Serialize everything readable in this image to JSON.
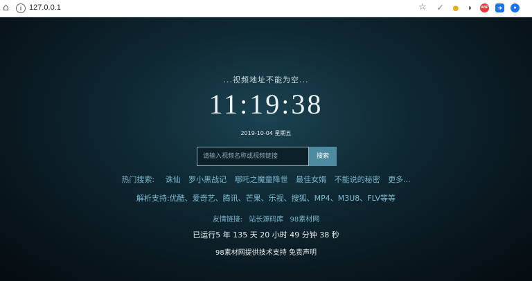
{
  "browser": {
    "url": "127.0.0.1",
    "info_icon": "i",
    "home_icon": "⌂",
    "star_icon": "☆",
    "extensions": [
      {
        "name": "check-icon",
        "glyph": "✓",
        "color": "#9aa0a6"
      },
      {
        "name": "smiley-extension-icon",
        "glyph": "☻",
        "color": "#f5c300"
      },
      {
        "name": "shield-extension-icon",
        "glyph": "◗",
        "color": "#3c4043"
      },
      {
        "name": "adblock-extension-icon",
        "glyph": "ABP",
        "color": "#e53935"
      },
      {
        "name": "arrow-extension-icon",
        "glyph": "➜",
        "color": "#1a73e8"
      },
      {
        "name": "circle-extension-icon",
        "glyph": "●",
        "color": "#1a73e8"
      }
    ]
  },
  "page": {
    "notice": "...视频地址不能为空...",
    "clock": "11:19:38",
    "date": "2019-10-04 星期五",
    "search": {
      "placeholder": "请输入视频名称或视频链接",
      "button": "搜索"
    },
    "hot": {
      "label": "热门搜索:",
      "items": [
        "诛仙",
        "罗小黑战记",
        "哪吒之魔童降世",
        "最佳女婿",
        "不能说的秘密",
        "更多..."
      ]
    },
    "support": "解析支持:优酷、爱奇艺、腾讯、芒果、乐视、搜狐、MP4、M3U8、FLV等等",
    "friends": {
      "label": "友情链接:",
      "links": [
        "站长源码库",
        "98素材网"
      ]
    },
    "uptime": "已运行5 年 135 天 20 小时 49 分钟 38 秒",
    "footer": "98素材网提供技术支持 免责声明"
  }
}
